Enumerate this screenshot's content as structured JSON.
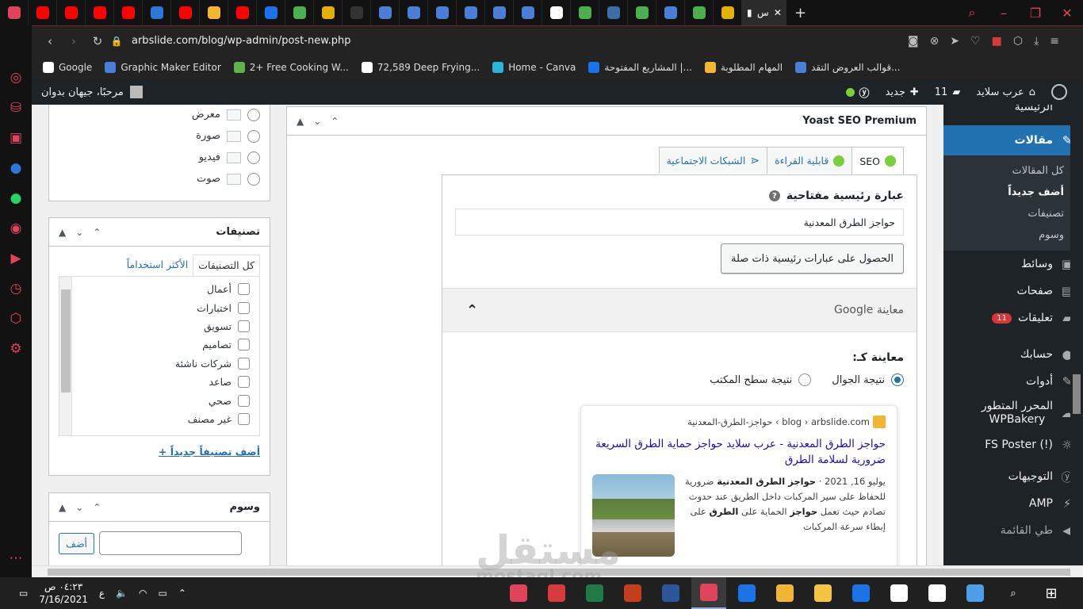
{
  "browser": {
    "active_tab_title": "س",
    "url": "arbslide.com/blog/wp-admin/post-new.php",
    "tab_favicons": [
      "#e0445a",
      "#ff0000",
      "#ff0000",
      "#ff0000",
      "#ff0000",
      "#2b78d8",
      "#ff0000",
      "#f2b632",
      "#ff0000",
      "#1a73e8",
      "#4caf50",
      "#e5b100",
      "#333333",
      "#4a7fd8",
      "#4a7fd8",
      "#4a7fd8",
      "#4a7fd8",
      "#4a7fd8",
      "#4a7fd8",
      "#ffffff",
      "#4caf50",
      "#3b6ea8",
      "#4caf50",
      "#4a7fd8",
      "#4caf50",
      "#e5b100"
    ],
    "window_controls": [
      "search-icon",
      "minimize-icon",
      "restore-icon",
      "close-icon"
    ]
  },
  "bookmarks": [
    {
      "label": "Google",
      "color": "#ffffff"
    },
    {
      "label": "Graphic Maker Editor",
      "color": "#4a7fd8"
    },
    {
      "label": "2+ Free Cooking W...",
      "color": "#5fb34a"
    },
    {
      "label": "72,589 Deep Frying...",
      "color": "#ffffff"
    },
    {
      "label": "Home - Canva",
      "color": "#2bb5d8"
    },
    {
      "label": "المشاريع المفتوحة |...",
      "color": "#1a73e8"
    },
    {
      "label": "المهام المطلوبة",
      "color": "#f2b632"
    },
    {
      "label": "قوالب العروض التقد...",
      "color": "#4a7fd8"
    }
  ],
  "wp_bar": {
    "site_name": "عرب سلايد",
    "comments_count": "11",
    "new_label": "جديد",
    "howdy": "مرحبًا، جيهان بدوان"
  },
  "wp_menu": {
    "home_label": "الرئيسية",
    "posts_label": "مقالات",
    "posts_submenu": [
      "كل المقالات",
      "أضف جديداً",
      "تصنيفات",
      "وسوم"
    ],
    "media_label": "وسائط",
    "pages_label": "صفحات",
    "comments_label": "تعليقات",
    "comments_badge": "11",
    "account_label": "حسابك",
    "tools_label": "أدوات",
    "wpbakery_line1": "المحرر المتطور",
    "wpbakery_line2": "WPBakery",
    "fsposter_label": "FS Poster (!)",
    "redirects_label": "التوجيهات",
    "amp_label": "AMP",
    "collapse_label": "طي القائمة"
  },
  "format_box": {
    "items": [
      "معرض",
      "صورة",
      "فيديو",
      "صوت"
    ]
  },
  "categories_box": {
    "title": "تصنيفات",
    "tab_all": "كل التصنيفات",
    "tab_popular": "الأكثر استخداماً",
    "items": [
      "أعمال",
      "اختبارات",
      "تسويق",
      "تصاميم",
      "شركات ناشئة",
      "صاعد",
      "صحي",
      "غير مصنف"
    ],
    "add_new": "+ أضف تصنيفاً جديداً"
  },
  "tags_box": {
    "title": "وسوم",
    "add_button": "أضف"
  },
  "yoast": {
    "box_title": "Yoast SEO Premium",
    "tabs": {
      "seo": "SEO",
      "readability": "قابلية القراءة",
      "social": "الشبكات الاجتماعية"
    },
    "focus_keyphrase_label": "عبارة رئيسية مفتاحية",
    "focus_keyphrase_value": "حواجز الطرق المعدنية",
    "related_button": "الحصول على عبارات رئيسية ذات صلة",
    "google_preview_label": "معاينة Google",
    "preview_as_label": "معاينة كـ:",
    "mobile_result": "نتيجة الجوال",
    "desktop_result": "نتيجة سطح المكتب",
    "snippet": {
      "url_path": "blog › arbslide.com › حواجز-الطرق-المعدنية",
      "title": "حواجز الطرق المعدنية - عرب سلايد حواجز حماية الطرق السريعة ضرورية لسلامة الطرق",
      "date": "يوليو 16, 2021 ·",
      "desc_bold_1": "حواجز الطرق المعدنية",
      "desc_1": " ضرورية للحفاظ على سير المركبات داخل الطريق عند حدوث تصادم حيث تعمل ",
      "desc_bold_2": "حواجز",
      "desc_2": " الحماية على ",
      "desc_bold_3": "الطرق",
      "desc_3": " على إبطاء سرعة المركبات"
    }
  },
  "watermark": {
    "arabic": "مستقل",
    "latin": "mostaql.com"
  },
  "taskbar": {
    "time": "٠٤:٢٣ ص",
    "date": "7/16/2021",
    "lang": "ع",
    "apps": [
      "#e0445a",
      "#d83b3b",
      "#1e7b45",
      "#c43e1c",
      "#2b579a",
      "#e0445a",
      "#1a73e8",
      "#f2b632",
      "#f5c542",
      "#1a73e8",
      "#ffffff",
      "#ffffff",
      "#4a9fe8"
    ]
  }
}
